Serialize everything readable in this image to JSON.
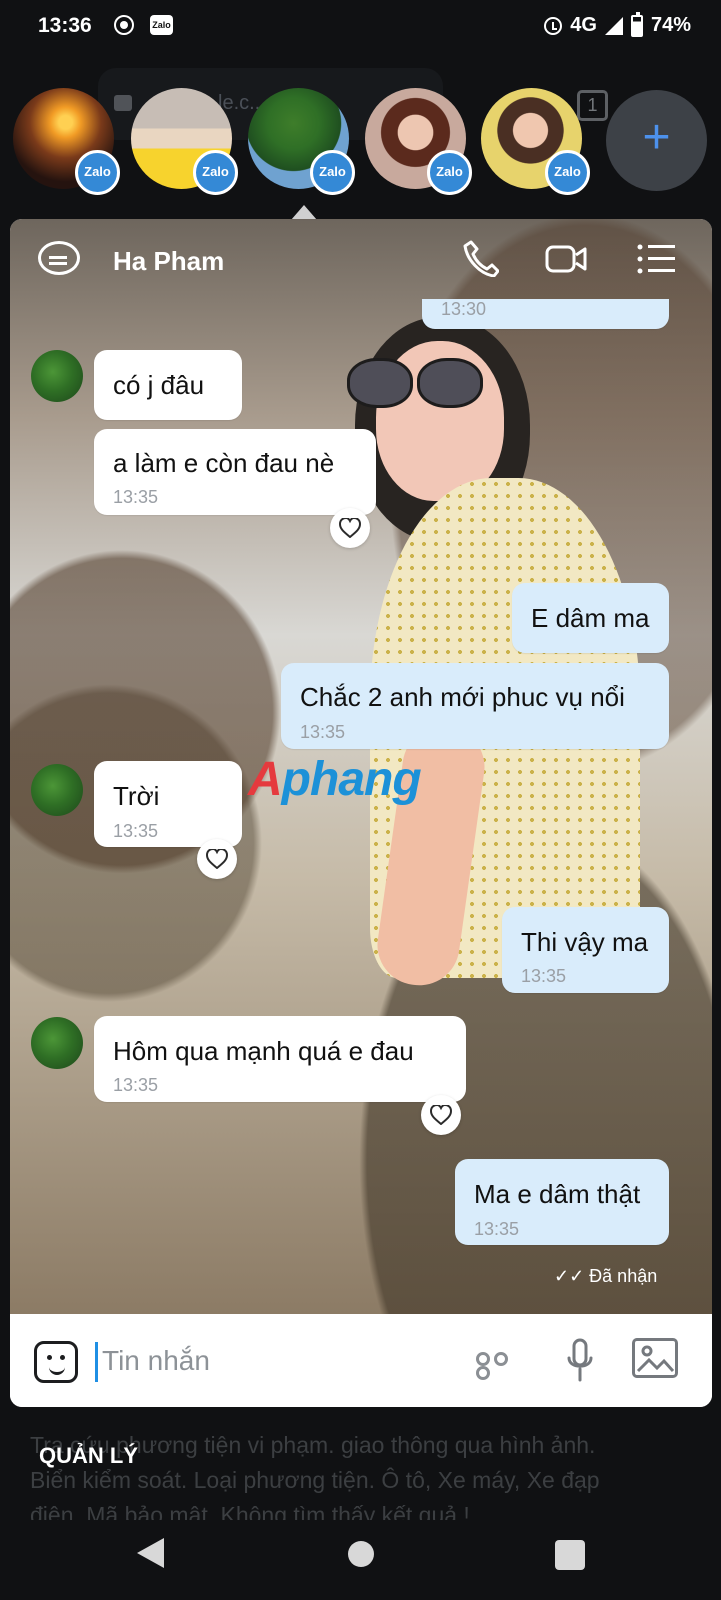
{
  "status_bar": {
    "time": "13:36",
    "network": "4G",
    "battery": "74%",
    "zalo_label": "Zalo"
  },
  "background": {
    "tab_count": "1",
    "url_text": "le.c... ear"
  },
  "recent_chats": [
    {
      "badge": "Zalo"
    },
    {
      "badge": "Zalo"
    },
    {
      "badge": "Zalo"
    },
    {
      "badge": "Zalo"
    },
    {
      "badge": "Zalo"
    }
  ],
  "add_label": "+",
  "chat_header": {
    "name": "Ha Pham"
  },
  "messages": [
    {
      "type": "sent",
      "time": "13:30"
    },
    {
      "type": "received",
      "text": "có j đâu"
    },
    {
      "type": "received",
      "text": "a làm e còn đau nè",
      "time": "13:35"
    },
    {
      "type": "sent",
      "text": "E dâm ma"
    },
    {
      "type": "sent",
      "text": "Chắc 2 anh mới phuc vụ nổi",
      "time": "13:35"
    },
    {
      "type": "received",
      "text": "Trời",
      "time": "13:35"
    },
    {
      "type": "sent",
      "text": "Thi vậy ma",
      "time": "13:35"
    },
    {
      "type": "received",
      "text": "Hôm qua mạnh quá e đau",
      "time": "13:35"
    },
    {
      "type": "sent",
      "text": "Ma e dâm thật",
      "time": "13:35"
    }
  ],
  "watermark": {
    "part1": "A",
    "part2": "phang"
  },
  "read_status": "Đã nhận",
  "composer": {
    "placeholder": "Tin nhắn"
  },
  "bottom": {
    "manage": "QUẢN LÝ",
    "ghost_lines": [
      "Tra cứu phương tiện vi phạm. giao thông qua hình ảnh.",
      "Biển kiểm soát. Loại phương tiện. Ô tô, Xe máy, Xe đạp",
      "điện. Mã bảo mật. Không tìm thấy kết quả !"
    ]
  },
  "colors": {
    "accent": "#1f8fe4",
    "sent_bubble": "#d9ecfb",
    "received_bubble": "#ffffff",
    "zalo_badge": "#3489d6"
  },
  "icons": [
    "chat-icon",
    "phone-icon",
    "video-icon",
    "menu-icon",
    "heart-icon",
    "emoji-icon",
    "more-icon",
    "mic-icon",
    "image-icon"
  ]
}
